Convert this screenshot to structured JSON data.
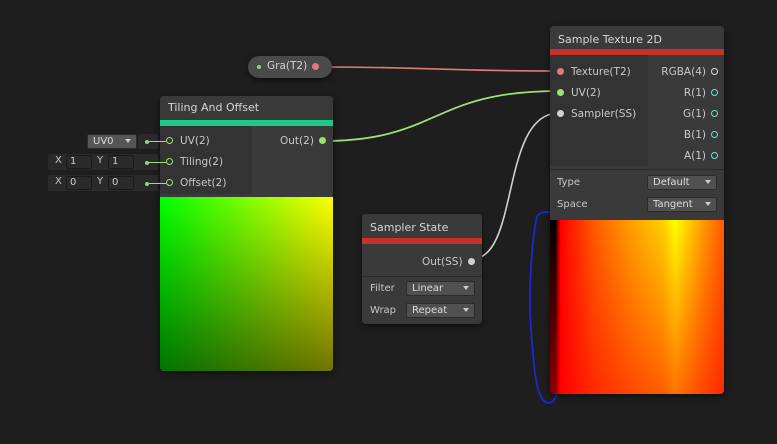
{
  "colors": {
    "background": "#1e1e1e",
    "node_body": "#3a3a3a",
    "tiling_bar": "#1ec98c",
    "texture_bar": "#c8312a",
    "wire_texture": "#e07a7a",
    "wire_uv": "#9ee06e",
    "wire_sampler": "#d0d0d0",
    "annotation": "#1a2ad0"
  },
  "gradient_node": {
    "label": "Gra(T2)"
  },
  "tiling_node": {
    "title": "Tiling And Offset",
    "inputs": [
      "UV(2)",
      "Tiling(2)",
      "Offset(2)"
    ],
    "output": "Out(2)",
    "uv_select": "UV0",
    "tiling": {
      "x_label": "X",
      "x": "1",
      "y_label": "Y",
      "y": "1"
    },
    "offset": {
      "x_label": "X",
      "x": "0",
      "y_label": "Y",
      "y": "0"
    }
  },
  "sampler_node": {
    "title": "Sampler State",
    "output": "Out(SS)",
    "filter_label": "Filter",
    "filter_value": "Linear",
    "wrap_label": "Wrap",
    "wrap_value": "Repeat"
  },
  "texture_node": {
    "title": "Sample Texture 2D",
    "inputs": [
      "Texture(T2)",
      "UV(2)",
      "Sampler(SS)"
    ],
    "outputs": [
      "RGBA(4)",
      "R(1)",
      "G(1)",
      "B(1)",
      "A(1)"
    ],
    "type_label": "Type",
    "type_value": "Default",
    "space_label": "Space",
    "space_value": "Tangent"
  }
}
